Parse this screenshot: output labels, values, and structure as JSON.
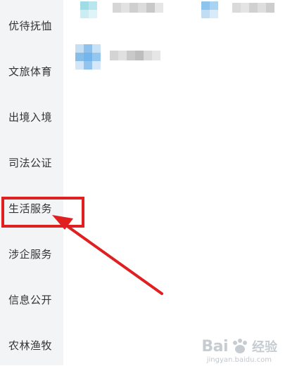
{
  "sidebar": {
    "items": [
      {
        "label": "优待抚恤"
      },
      {
        "label": "文旅体育"
      },
      {
        "label": "出境入境"
      },
      {
        "label": "司法公证"
      },
      {
        "label": "生活服务"
      },
      {
        "label": "涉企服务"
      },
      {
        "label": "信息公开"
      },
      {
        "label": "农林渔牧"
      }
    ],
    "highlighted_item": "生活服务"
  },
  "colors": {
    "sidebar_bg": "#f3f4f6",
    "highlight_red": "#e02020",
    "icon_blue": "#74b6ec",
    "icon_teal": "#7fd3df"
  },
  "watermark": {
    "logo": "Bai",
    "logo_suffix": "经验",
    "url": "jingyan.baidu.com"
  }
}
